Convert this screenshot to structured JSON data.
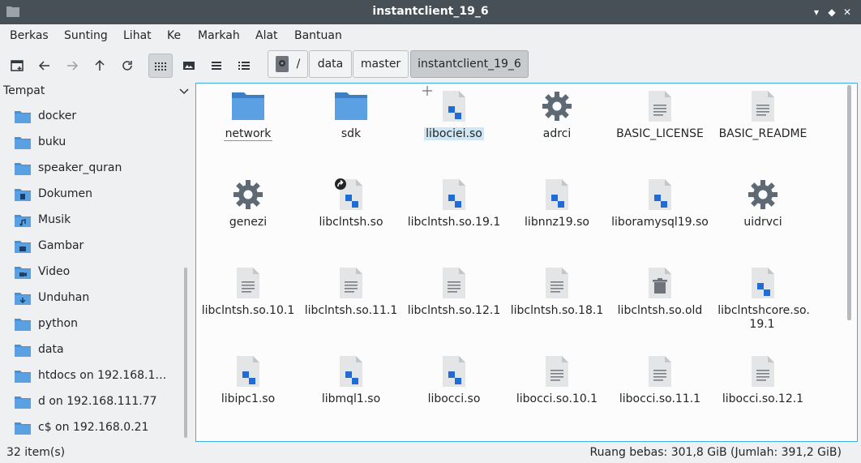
{
  "window": {
    "title": "instantclient_19_6"
  },
  "menu": [
    "Berkas",
    "Sunting",
    "Lihat",
    "Ke",
    "Markah",
    "Alat",
    "Bantuan"
  ],
  "breadcrumb": [
    "/",
    "data",
    "master",
    "instantclient_19_6"
  ],
  "sidebar": {
    "heading": "Tempat",
    "items": [
      {
        "label": "docker",
        "icon": "folder-icon"
      },
      {
        "label": "buku",
        "icon": "folder-icon"
      },
      {
        "label": "speaker_quran",
        "icon": "folder-icon"
      },
      {
        "label": "Dokumen",
        "icon": "folder-documents-icon"
      },
      {
        "label": "Musik",
        "icon": "folder-music-icon"
      },
      {
        "label": "Gambar",
        "icon": "folder-pictures-icon"
      },
      {
        "label": "Video",
        "icon": "folder-videos-icon"
      },
      {
        "label": "Unduhan",
        "icon": "folder-downloads-icon"
      },
      {
        "label": "python",
        "icon": "folder-icon"
      },
      {
        "label": "data",
        "icon": "folder-icon"
      },
      {
        "label": "htdocs on 192.168.11...",
        "icon": "network-folder-icon"
      },
      {
        "label": "d on 192.168.111.77",
        "icon": "network-folder-icon"
      },
      {
        "label": "c$ on 192.168.0.21",
        "icon": "network-folder-icon"
      }
    ]
  },
  "files": [
    {
      "name": "network",
      "type": "folder"
    },
    {
      "name": "sdk",
      "type": "folder"
    },
    {
      "name": "libociei.so",
      "type": "lib",
      "selected": true
    },
    {
      "name": "adrci",
      "type": "exec"
    },
    {
      "name": "BASIC_LICENSE",
      "type": "text"
    },
    {
      "name": "BASIC_README",
      "type": "text"
    },
    {
      "name": "genezi",
      "type": "exec"
    },
    {
      "name": "libclntsh.so",
      "type": "lib",
      "link": true
    },
    {
      "name": "libclntsh.so.19.1",
      "type": "lib"
    },
    {
      "name": "libnnz19.so",
      "type": "lib"
    },
    {
      "name": "liboramysql19.so",
      "type": "lib"
    },
    {
      "name": "uidrvci",
      "type": "exec"
    },
    {
      "name": "libclntsh.so.10.1",
      "type": "text"
    },
    {
      "name": "libclntsh.so.11.1",
      "type": "text"
    },
    {
      "name": "libclntsh.so.12.1",
      "type": "text"
    },
    {
      "name": "libclntsh.so.18.1",
      "type": "text"
    },
    {
      "name": "libclntsh.so.old",
      "type": "trash"
    },
    {
      "name": "libclntshcore.so.\n19.1",
      "type": "lib"
    },
    {
      "name": "libipc1.so",
      "type": "lib"
    },
    {
      "name": "libmql1.so",
      "type": "lib"
    },
    {
      "name": "libocci.so",
      "type": "lib"
    },
    {
      "name": "libocci.so.10.1",
      "type": "text"
    },
    {
      "name": "libocci.so.11.1",
      "type": "text"
    },
    {
      "name": "libocci.so.12.1",
      "type": "text"
    }
  ],
  "status": {
    "count": "32 item(s)",
    "free": "Ruang bebas: 301,8 GiB (Jumlah: 391,2 GiB)"
  },
  "colors": {
    "accent": "#3daee9",
    "folder": "#4a90d9",
    "titlebar": "#475057"
  }
}
